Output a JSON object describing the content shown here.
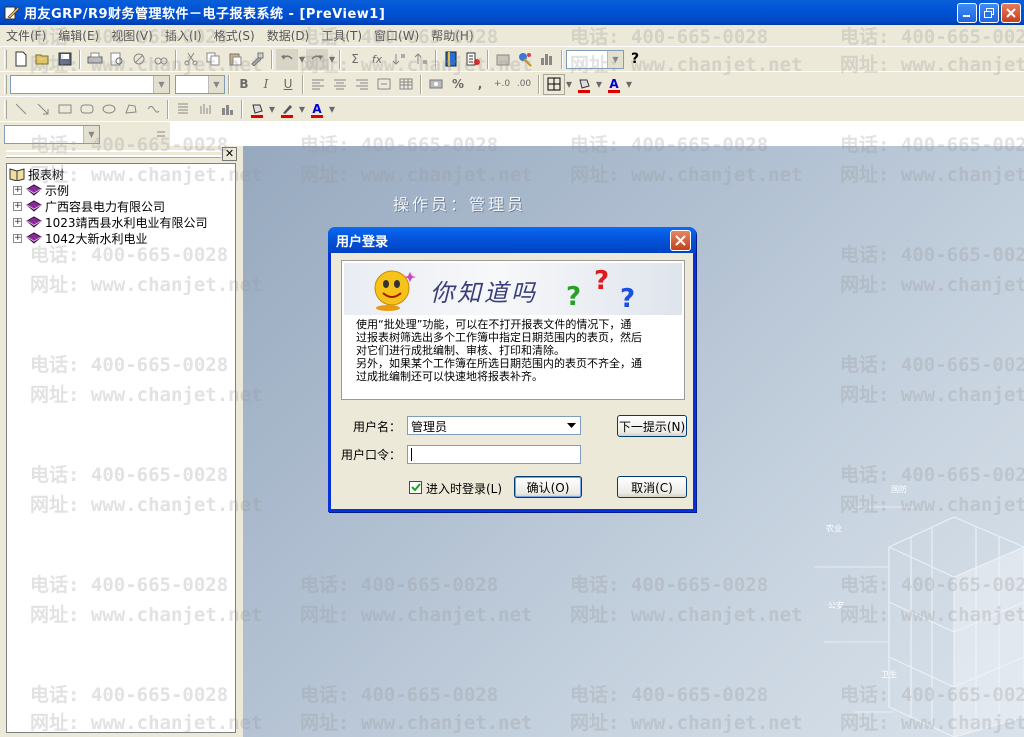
{
  "window": {
    "title": "用友GRP/R9财务管理软件－电子报表系统 - [PreView1]"
  },
  "menu": [
    "文件(F)",
    "编辑(E)",
    "视图(V)",
    "插入(I)",
    "格式(S)",
    "数据(D)",
    "工具(T)",
    "窗口(W)",
    "帮助(H)"
  ],
  "toolbar": {
    "bold": "B",
    "italic": "I",
    "underline": "U",
    "percent": "%",
    "comma": ",",
    "sum": "Σ",
    "fx": "fx",
    "help": "?"
  },
  "tree": {
    "root": "报表树",
    "items": [
      "示例",
      "广西容县电力有限公司",
      "1023靖西县水利电业有限公司",
      "1042大新水利电业"
    ]
  },
  "main": {
    "operator": "操作员：管理员",
    "watermark_phone": "电话: 400-665-0028",
    "watermark_site": "网址: www.chanjet.net",
    "deco_labels": [
      "国防",
      "农业",
      "公安",
      "卫生"
    ]
  },
  "dialog": {
    "title": "用户登录",
    "tip_heading": "你知道吗",
    "tip_lines": [
      "使用“批处理”功能，可以在不打开报表文件的情况下，通",
      "过报表树筛选出多个工作簿中指定日期范围内的表页，然后",
      "对它们进行成批编制、审核、打印和清除。",
      "另外，如果某个工作簿在所选日期范围内的表页不齐全，通",
      "过成批编制还可以快速地将报表补齐。"
    ],
    "username_label": "用户名：",
    "username_value": "管理员",
    "password_label": "用户口令：",
    "password_value": "",
    "next_tip_button": "下一提示(N)",
    "auto_login_label": "进入时登录(L)",
    "auto_login_checked": true,
    "ok_button": "确认(O)",
    "cancel_button": "取消(C)"
  },
  "colors": {
    "titlebar": "#0053d6",
    "dialog_border": "#0831d9",
    "tip_heading": "#3a3f77",
    "fill_red": "#e00000",
    "text_blue": "#0000cc"
  }
}
